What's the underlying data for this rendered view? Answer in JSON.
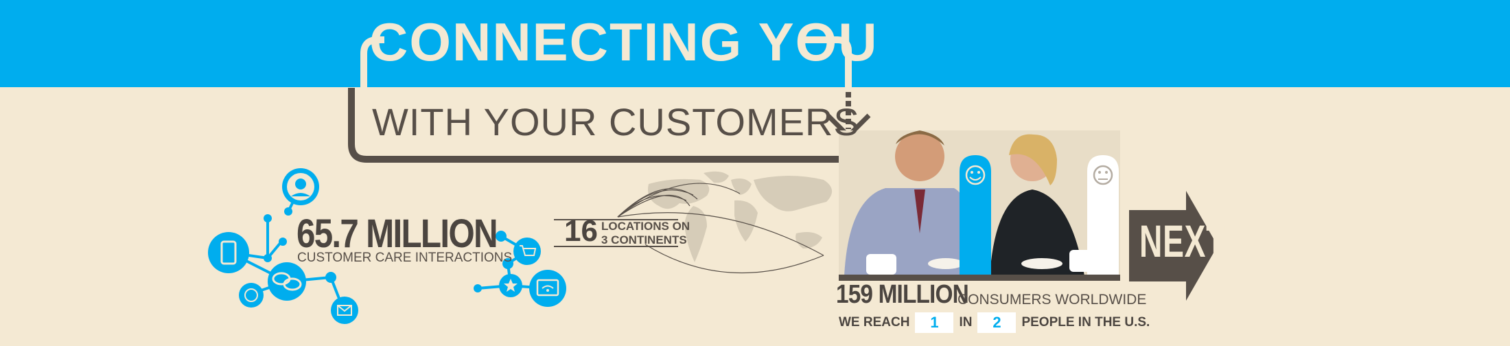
{
  "banner": {
    "headline": "CONNECTING YOU",
    "subhead": "WITH YOUR CUSTOMERS"
  },
  "stats": {
    "interactions": {
      "value": "65.7 MILLION",
      "label": "CUSTOMER CARE INTERACTIONS"
    },
    "locations": {
      "value": "16",
      "label_line1": "LOCATIONS ON",
      "label_line2": "3 CONTINENTS"
    },
    "consumers": {
      "value": "159 MILLION",
      "label": "CONSUMERS WORLDWIDE"
    },
    "reach": {
      "prefix": "WE REACH",
      "numerator": "1",
      "middle": "IN",
      "denominator": "2",
      "suffix": "PEOPLE IN THE U.S."
    }
  },
  "navigation": {
    "next_label": "NEXT"
  },
  "colors": {
    "blue": "#00adee",
    "cream": "#f4e9d3",
    "brown": "#574f48"
  },
  "icons": [
    "headset-icon",
    "phone-icon",
    "chat-icon",
    "smiley-icon",
    "mail-icon",
    "cart-icon",
    "star-icon",
    "wifi-icon",
    "happy-face-icon",
    "neutral-face-icon",
    "down-arrow-icon",
    "world-map"
  ]
}
